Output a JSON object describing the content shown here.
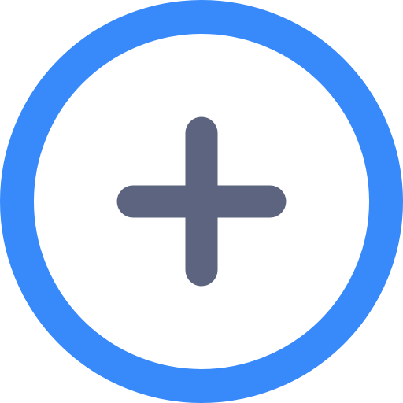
{
  "icon": {
    "name": "add-circle-icon",
    "ring_color": "#388AFB",
    "plus_color": "#5D647F",
    "background_color": "#FFFFFF"
  }
}
